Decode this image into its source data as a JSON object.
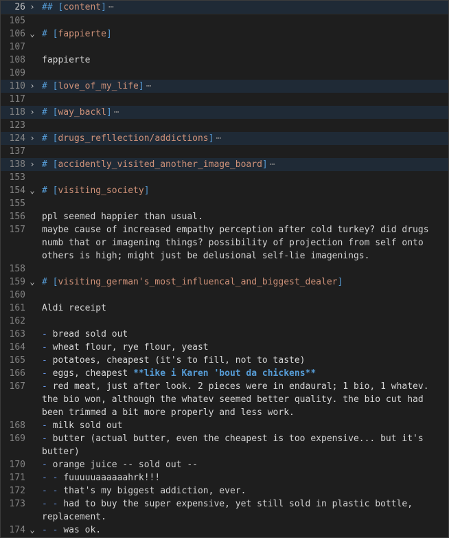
{
  "lines": [
    {
      "n": "26",
      "fold": "›",
      "type": "heading",
      "hash": "##",
      "title": "content",
      "folded": true
    },
    {
      "n": "105",
      "type": "empty"
    },
    {
      "n": "106",
      "fold": "⌄",
      "type": "heading",
      "hash": "#",
      "title": "fappierte"
    },
    {
      "n": "107",
      "type": "empty"
    },
    {
      "n": "108",
      "type": "text",
      "text": "fappierte"
    },
    {
      "n": "109",
      "type": "empty"
    },
    {
      "n": "110",
      "fold": "›",
      "type": "heading",
      "hash": "#",
      "title": "love_of_my_life",
      "folded": true
    },
    {
      "n": "117",
      "type": "empty"
    },
    {
      "n": "118",
      "fold": "›",
      "type": "heading",
      "hash": "#",
      "title": "way_backl",
      "folded": true
    },
    {
      "n": "123",
      "type": "empty"
    },
    {
      "n": "124",
      "fold": "›",
      "type": "heading",
      "hash": "#",
      "title": "drugs_refllection/addictions",
      "folded": true
    },
    {
      "n": "137",
      "type": "empty"
    },
    {
      "n": "138",
      "fold": "›",
      "type": "heading",
      "hash": "#",
      "title": "accidently_visited_another_image_board",
      "folded": true
    },
    {
      "n": "153",
      "type": "empty"
    },
    {
      "n": "154",
      "fold": "⌄",
      "type": "heading",
      "hash": "#",
      "title": "visiting_society"
    },
    {
      "n": "155",
      "type": "empty"
    },
    {
      "n": "156",
      "type": "text",
      "text": "ppl seemed happier than usual."
    },
    {
      "n": "157",
      "type": "text",
      "text": "maybe cause of increased empathy perception after cold turkey? did drugs numb that or imagening things? possibility of projection from self onto others is high; might just be delusional self-lie imagenings.",
      "wrap": true
    },
    {
      "n": "158",
      "type": "empty"
    },
    {
      "n": "159",
      "fold": "⌄",
      "type": "heading",
      "hash": "#",
      "title": "visiting_german's_most_influencal_and_biggest_dealer"
    },
    {
      "n": "160",
      "type": "empty"
    },
    {
      "n": "161",
      "type": "text",
      "text": "Aldi receipt"
    },
    {
      "n": "162",
      "type": "empty"
    },
    {
      "n": "163",
      "type": "list",
      "dash": "- ",
      "text": "bread sold out"
    },
    {
      "n": "164",
      "type": "list",
      "dash": "- ",
      "text": "wheat flour, rye flour, yeast"
    },
    {
      "n": "165",
      "type": "list",
      "dash": "- ",
      "text": "potatoes, cheapest (it's to fill, not to taste)"
    },
    {
      "n": "166",
      "type": "list",
      "dash": "- ",
      "text": "eggs, cheapest ",
      "bold": "**like i Karen 'bout da chickens**"
    },
    {
      "n": "167",
      "type": "list",
      "dash": "- ",
      "text": "red meat, just after look. 2 pieces were in endaural; 1 bio, 1 whatev. the bio won, although the whatev seemed better quality. the bio cut had been trimmed a bit more properly and less work.",
      "wrap": true
    },
    {
      "n": "168",
      "type": "list",
      "dash": "- ",
      "text": "milk sold out"
    },
    {
      "n": "169",
      "type": "list",
      "dash": "- ",
      "text": "butter (actual butter, even the cheapest is too expensive... but it's butter)",
      "wrap": true
    },
    {
      "n": "170",
      "type": "list",
      "dash": "- ",
      "text": "orange juice -- sold out --"
    },
    {
      "n": "171",
      "type": "list",
      "dash": "- - ",
      "text": "fuuuuuaaaaaahrk!!!"
    },
    {
      "n": "172",
      "type": "list",
      "dash": "- - ",
      "text": "that's my biggest addiction, ever."
    },
    {
      "n": "173",
      "type": "list",
      "dash": "- - ",
      "text": "had to buy the super expensive, yet still sold in plastic bottle, replacement.",
      "wrap": true
    },
    {
      "n": "174",
      "fold": "⌄",
      "type": "list",
      "dash": "- - ",
      "text": "was ok."
    }
  ],
  "ellipsis": "⋯",
  "colors": {
    "background": "#1e1e1e",
    "heading": "#ce9178",
    "markup": "#569cd6",
    "line_number": "#858585",
    "folded_bg": "#1f2a36"
  }
}
